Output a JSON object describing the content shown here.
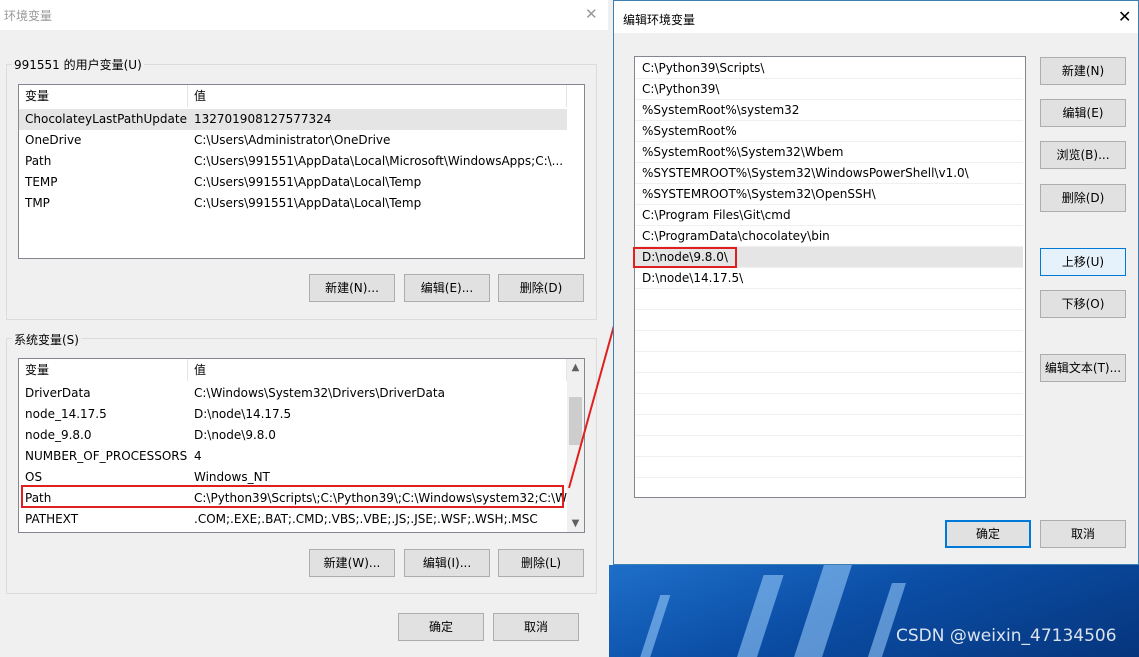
{
  "left_dialog": {
    "title": "环境变量",
    "close_glyph": "✕",
    "user_group_label": "991551 的用户变量(U)",
    "system_group_label": "系统变量(S)",
    "columns": {
      "name": "变量",
      "value": "值"
    },
    "user_vars": [
      {
        "name": "ChocolateyLastPathUpdate",
        "value": "132701908127577324"
      },
      {
        "name": "OneDrive",
        "value": "C:\\Users\\Administrator\\OneDrive"
      },
      {
        "name": "Path",
        "value": "C:\\Users\\991551\\AppData\\Local\\Microsoft\\WindowsApps;C:\\..."
      },
      {
        "name": "TEMP",
        "value": "C:\\Users\\991551\\AppData\\Local\\Temp"
      },
      {
        "name": "TMP",
        "value": "C:\\Users\\991551\\AppData\\Local\\Temp"
      }
    ],
    "system_vars": [
      {
        "name": "DriverData",
        "value": "C:\\Windows\\System32\\Drivers\\DriverData"
      },
      {
        "name": "node_14.17.5",
        "value": "D:\\node\\14.17.5"
      },
      {
        "name": "node_9.8.0",
        "value": "D:\\node\\9.8.0"
      },
      {
        "name": "NUMBER_OF_PROCESSORS",
        "value": "4"
      },
      {
        "name": "OS",
        "value": "Windows_NT"
      },
      {
        "name": "Path",
        "value": "C:\\Python39\\Scripts\\;C:\\Python39\\;C:\\Windows\\system32;C:\\W..."
      },
      {
        "name": "PATHEXT",
        "value": ".COM;.EXE;.BAT;.CMD;.VBS;.VBE;.JS;.JSE;.WSF;.WSH;.MSC"
      }
    ],
    "user_buttons": {
      "new": "新建(N)...",
      "edit": "编辑(E)...",
      "delete": "删除(D)"
    },
    "system_buttons": {
      "new": "新建(W)...",
      "edit": "编辑(I)...",
      "delete": "删除(L)"
    },
    "ok": "确定",
    "cancel": "取消"
  },
  "right_dialog": {
    "title": "编辑环境变量",
    "close_glyph": "✕",
    "paths": [
      "C:\\Python39\\Scripts\\",
      "C:\\Python39\\",
      "%SystemRoot%\\system32",
      "%SystemRoot%",
      "%SystemRoot%\\System32\\Wbem",
      "%SYSTEMROOT%\\System32\\WindowsPowerShell\\v1.0\\",
      "%SYSTEMROOT%\\System32\\OpenSSH\\",
      "C:\\Program Files\\Git\\cmd",
      "C:\\ProgramData\\chocolatey\\bin",
      "D:\\node\\9.8.0\\",
      "D:\\node\\14.17.5\\"
    ],
    "buttons": {
      "new": "新建(N)",
      "edit": "编辑(E)",
      "browse": "浏览(B)...",
      "delete": "删除(D)",
      "move_up": "上移(U)",
      "move_down": "下移(O)",
      "edit_text": "编辑文本(T)..."
    },
    "ok": "确定",
    "cancel": "取消"
  },
  "watermark": "CSDN @weixin_47134506",
  "colors": {
    "annotation_red": "#e02020",
    "focus_blue": "#0078d7",
    "wallpaper_blue": "#0b4ea6"
  }
}
